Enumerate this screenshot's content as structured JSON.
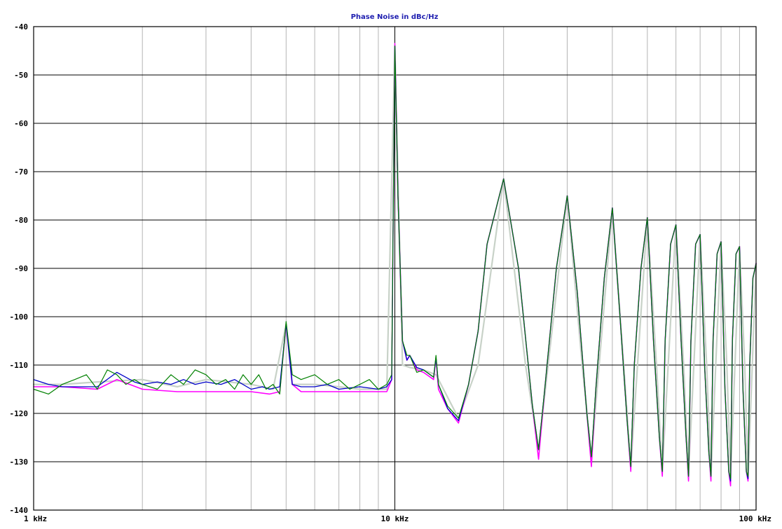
{
  "chart_data": {
    "type": "line",
    "title": "Phase Noise in dBc/Hz",
    "xscale": "log",
    "xlim_hz": [
      1000,
      100000
    ],
    "ylim": [
      -140,
      -40
    ],
    "grid": true,
    "y_ticks": [
      "-40",
      "-50",
      "-60",
      "-70",
      "-80",
      "-90",
      "-100",
      "-110",
      "-120",
      "-130",
      "-140"
    ],
    "x_ticks": [
      "1 kHz",
      "10 kHz",
      "100 kHz"
    ],
    "colors": {
      "title": "#1f1fb0",
      "grid_major": "#000000",
      "grid_minor": "#b4b4b4",
      "trace_gray": "#c8d2c8",
      "trace_magenta": "#ff00ff",
      "trace_blue": "#0000c8",
      "trace_green": "#008000"
    },
    "series": [
      {
        "color": "trace_gray",
        "x": [
          1000,
          1200,
          1500,
          2000,
          2500,
          3000,
          4000,
          4600,
          5000,
          5200,
          6000,
          7000,
          8000,
          9500,
          10000,
          10500,
          11000,
          12000,
          13000,
          15000,
          17000,
          20000,
          23000,
          25000,
          30000,
          33000,
          35000,
          40000,
          43000,
          45000,
          50000,
          53000,
          55000,
          60000,
          63000,
          65000,
          70000,
          73000,
          75000,
          80000,
          83000,
          85000,
          90000,
          93000,
          95000,
          100000
        ],
        "y": [
          -114,
          -114,
          -113.5,
          -113,
          -114.5,
          -113,
          -114,
          -115,
          -101.5,
          -114,
          -114,
          -114.5,
          -115,
          -115,
          -44,
          -110,
          -110.5,
          -111,
          -112,
          -121,
          -110,
          -71.5,
          -110,
          -127.5,
          -75,
          -110,
          -129,
          -77.5,
          -110,
          -131,
          -79.5,
          -110,
          -132,
          -81,
          -110,
          -133,
          -83,
          -110,
          -133,
          -84.5,
          -110,
          -133.5,
          -85.5,
          -110,
          -133.5,
          -89
        ]
      },
      {
        "color": "trace_magenta",
        "x": [
          1000,
          1200,
          1500,
          1700,
          2000,
          2500,
          3000,
          4000,
          4500,
          4800,
          5000,
          5200,
          5500,
          6000,
          7000,
          8000,
          9000,
          9500,
          9800,
          10000,
          10200,
          10500,
          10800,
          11000,
          11500,
          12000,
          12800,
          13000,
          13200,
          14000,
          15000,
          16000,
          17000,
          18000,
          20000,
          22000,
          24000,
          25000,
          26000,
          28000,
          30000,
          32000,
          34000,
          35000,
          36000,
          38000,
          40000,
          42000,
          44000,
          45000,
          46000,
          48000,
          50000,
          52000,
          54000,
          55000,
          56000,
          58000,
          60000,
          62000,
          64000,
          65000,
          66000,
          68000,
          70000,
          72000,
          74000,
          75000,
          76000,
          78000,
          80000,
          82000,
          84000,
          85000,
          86000,
          88000,
          90000,
          92000,
          94000,
          95000,
          96000,
          98000,
          100000
        ],
        "y": [
          -114.5,
          -114.5,
          -115,
          -113,
          -115,
          -115.5,
          -115.5,
          -115.5,
          -116,
          -115.5,
          -101.5,
          -114,
          -115.5,
          -115.5,
          -115.5,
          -115.5,
          -115.5,
          -115.5,
          -113,
          -43.5,
          -75,
          -105,
          -109,
          -108,
          -111,
          -111.5,
          -113,
          -108.5,
          -115,
          -119,
          -122,
          -114,
          -103,
          -85,
          -71.5,
          -90,
          -118,
          -129.5,
          -115,
          -90,
          -75,
          -95,
          -120,
          -131,
          -115,
          -92,
          -77.5,
          -100,
          -122,
          -132,
          -110,
          -90,
          -79.5,
          -105,
          -125,
          -133,
          -105,
          -85,
          -81,
          -105,
          -125,
          -134,
          -105,
          -85,
          -83,
          -110,
          -128,
          -134,
          -105,
          -87,
          -84.5,
          -115,
          -132,
          -135,
          -105,
          -87,
          -85.5,
          -115,
          -132,
          -134,
          -110,
          -92,
          -89
        ]
      },
      {
        "color": "trace_blue",
        "x": [
          1000,
          1100,
          1200,
          1500,
          1700,
          1900,
          2000,
          2200,
          2400,
          2600,
          2800,
          3000,
          3300,
          3600,
          4000,
          4300,
          4500,
          4800,
          5000,
          5200,
          5500,
          6000,
          6500,
          7000,
          8000,
          9000,
          9500,
          9800,
          10000,
          10200,
          10500,
          10800,
          11000,
          11500,
          12000,
          12800,
          13000,
          13200,
          14000,
          15000,
          16000,
          17000,
          18000,
          20000,
          22000,
          24000,
          25000,
          26000,
          28000,
          30000,
          32000,
          34000,
          35000,
          36000,
          38000,
          40000,
          42000,
          44000,
          45000,
          46000,
          48000,
          50000,
          52000,
          54000,
          55000,
          56000,
          58000,
          60000,
          62000,
          64000,
          65000,
          66000,
          68000,
          70000,
          72000,
          74000,
          75000,
          76000,
          78000,
          80000,
          82000,
          84000,
          85000,
          86000,
          88000,
          90000,
          92000,
          94000,
          95000,
          96000,
          98000,
          100000
        ],
        "y": [
          -113,
          -114,
          -114.5,
          -114.5,
          -111.5,
          -113.5,
          -114,
          -113.5,
          -114,
          -113,
          -114,
          -113.5,
          -114,
          -113,
          -115,
          -114.5,
          -115,
          -114.5,
          -101.5,
          -114,
          -114.5,
          -114.5,
          -114,
          -115,
          -114.5,
          -115,
          -114.5,
          -113,
          -44,
          -75,
          -105,
          -109,
          -108,
          -110.5,
          -111,
          -112.5,
          -108.5,
          -114,
          -119,
          -121.5,
          -114,
          -103,
          -85,
          -71.5,
          -90,
          -118,
          -127.5,
          -115,
          -90,
          -75,
          -95,
          -120,
          -129,
          -115,
          -92,
          -77.5,
          -100,
          -122,
          -131,
          -110,
          -90,
          -79.5,
          -105,
          -125,
          -132,
          -105,
          -85,
          -81,
          -105,
          -125,
          -133,
          -105,
          -85,
          -83,
          -110,
          -128,
          -133,
          -105,
          -87,
          -84.5,
          -115,
          -132,
          -134,
          -105,
          -87,
          -85.5,
          -115,
          -132,
          -133.5,
          -110,
          -92,
          -89
        ]
      },
      {
        "color": "trace_green",
        "x": [
          1000,
          1100,
          1200,
          1300,
          1400,
          1500,
          1600,
          1700,
          1800,
          1900,
          2000,
          2200,
          2400,
          2600,
          2800,
          3000,
          3200,
          3400,
          3600,
          3800,
          4000,
          4200,
          4400,
          4600,
          4800,
          5000,
          5200,
          5500,
          6000,
          6500,
          7000,
          7500,
          8000,
          8500,
          9000,
          9500,
          9800,
          10000,
          10200,
          10500,
          10800,
          11000,
          11500,
          12000,
          12800,
          13000,
          13200,
          14000,
          15000,
          16000,
          17000,
          18000,
          20000,
          22000,
          24000,
          25000,
          26000,
          28000,
          30000,
          32000,
          34000,
          35000,
          36000,
          38000,
          40000,
          42000,
          44000,
          45000,
          46000,
          48000,
          50000,
          52000,
          54000,
          55000,
          56000,
          58000,
          60000,
          62000,
          64000,
          65000,
          66000,
          68000,
          70000,
          72000,
          74000,
          75000,
          76000,
          78000,
          80000,
          82000,
          84000,
          85000,
          86000,
          88000,
          90000,
          92000,
          94000,
          95000,
          96000,
          98000,
          100000
        ],
        "y": [
          -115,
          -116,
          -114,
          -113,
          -112,
          -115,
          -111,
          -112,
          -114,
          -113,
          -114,
          -115,
          -112,
          -114,
          -111,
          -112,
          -114,
          -113,
          -115,
          -112,
          -114,
          -112,
          -115,
          -114,
          -116,
          -101,
          -112,
          -113,
          -112,
          -114,
          -113,
          -115,
          -114,
          -113,
          -115,
          -114,
          -112,
          -44,
          -75,
          -105,
          -108,
          -108,
          -111.5,
          -111,
          -112.5,
          -108,
          -114,
          -118.5,
          -121,
          -114,
          -103,
          -85,
          -71.5,
          -90,
          -118,
          -127.5,
          -115,
          -90,
          -75,
          -95,
          -120,
          -129,
          -115,
          -92,
          -77.5,
          -100,
          -122,
          -131,
          -110,
          -90,
          -79.5,
          -105,
          -125,
          -132,
          -105,
          -85,
          -81,
          -105,
          -125,
          -133,
          -105,
          -85,
          -83,
          -110,
          -128,
          -133,
          -105,
          -87,
          -84.5,
          -115,
          -132,
          -133.5,
          -105,
          -87,
          -85.5,
          -115,
          -132,
          -133,
          -110,
          -92,
          -89
        ]
      }
    ]
  }
}
